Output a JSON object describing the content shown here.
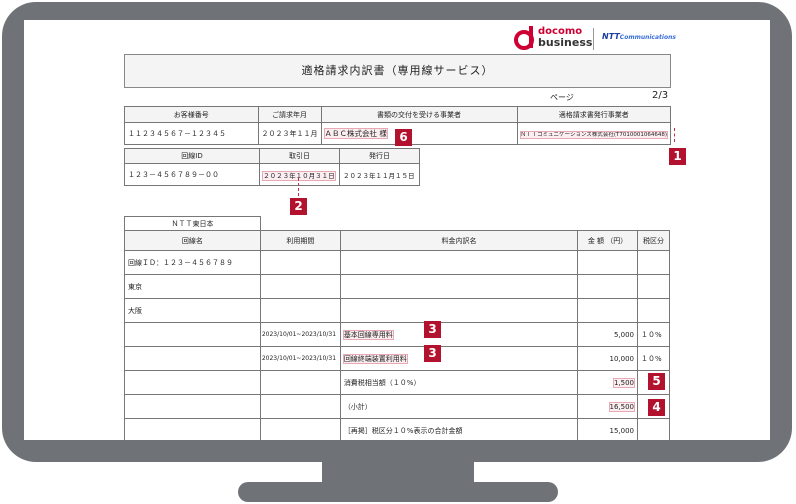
{
  "logo": {
    "docomo": "docomo",
    "business": "business",
    "ntt": "NTT",
    "ntt_comm": "Communications"
  },
  "document": {
    "title": "適格請求内訳書（専用線サービス）",
    "page_label": "ページ",
    "page_value": "2/3"
  },
  "header_table": {
    "headers": [
      "お客様番号",
      "ご請求年月",
      "書類の交付を受ける事業者",
      "適格請求書発行事業者"
    ],
    "values": [
      "１１２３４５６７－１２３４５",
      "２０２３年１１月",
      "ＡＢＣ株式会社 様",
      "ＮＴＴコミュニケーションズ株式会社(T7010001064648)"
    ]
  },
  "circuit_table": {
    "headers": [
      "回線ID",
      "取引日",
      "発行日"
    ],
    "values": [
      "１２３－４５６７８９－００",
      "２０２３年１０月３１日",
      "２０２３年１１月１５日"
    ]
  },
  "carrier": "ＮＴＴ東日本",
  "detail_table": {
    "headers": [
      "回線名",
      "利用期間",
      "料金内訳名",
      "金 額 （円）",
      "税区分"
    ],
    "rows": [
      {
        "name": "回線ＩＤ：１２３－４５６７８９",
        "period": "",
        "item": "",
        "amount": "",
        "tax": ""
      },
      {
        "name": "東京",
        "period": "",
        "item": "",
        "amount": "",
        "tax": ""
      },
      {
        "name": "大阪",
        "period": "",
        "item": "",
        "amount": "",
        "tax": ""
      },
      {
        "name": "",
        "period": "2023/10/01~2023/10/31",
        "item": "基本回線専用料",
        "amount": "5,000",
        "tax": "１０%"
      },
      {
        "name": "",
        "period": "2023/10/01~2023/10/31",
        "item": "回線終端装置利用料",
        "amount": "10,000",
        "tax": "１０%"
      },
      {
        "name": "",
        "period": "",
        "item": "消費税相当額（１０%）",
        "amount": "1,500",
        "tax": ""
      },
      {
        "name": "",
        "period": "",
        "item": "（小計）",
        "amount": "16,500",
        "tax": ""
      },
      {
        "name": "",
        "period": "",
        "item": "［再掲］税区分１０%表示の合計金額",
        "amount": "15,000",
        "tax": ""
      }
    ]
  },
  "badges": [
    "1",
    "2",
    "3",
    "3",
    "4",
    "5",
    "6"
  ],
  "colors": {
    "bezel": "#6f7378",
    "accent": "#b3122e",
    "highlight": "#fbeef1"
  }
}
